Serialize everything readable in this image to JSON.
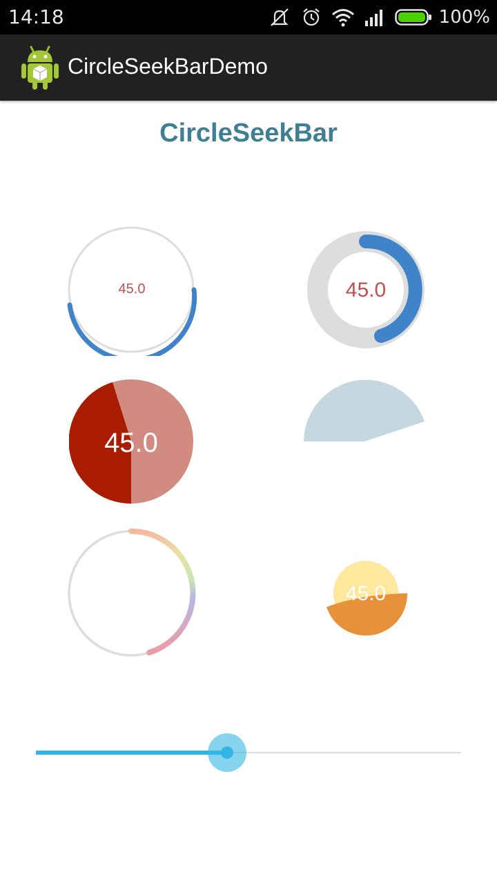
{
  "status_bar": {
    "time": "14:18",
    "battery_text": "100%",
    "icons": [
      "silent-icon",
      "alarm-icon",
      "wifi-icon",
      "signal-icon",
      "battery-icon"
    ]
  },
  "action_bar": {
    "app_icon": "android-icon",
    "title": "CircleSeekBarDemo"
  },
  "page": {
    "title": "CircleSeekBar"
  },
  "seekbars": {
    "ring_blue": {
      "value_text": "45.0",
      "progress": 0.45,
      "track_color": "#dddddd",
      "progress_color": "#3f84c9",
      "text_color": "#c0504d"
    },
    "ring_thick": {
      "value_text": "45.0",
      "progress": 0.45,
      "track_color": "#dddddd",
      "progress_color": "#3f84c9",
      "text_color": "#c0504d"
    },
    "pie_red": {
      "value_text": "45.0",
      "progress": 0.45,
      "track_color": "#d28b80",
      "progress_color": "#a91c00",
      "text_color": "#ffffff"
    },
    "sector_gray": {
      "progress": 0.45,
      "color": "#c5d8e0"
    },
    "ring_rainbow": {
      "progress": 0.45,
      "track_color": "#dddddd",
      "gradient": [
        "#f4b9a0",
        "#e9e2a4",
        "#c9e4b7",
        "#b7b7e0",
        "#f09aa6"
      ]
    },
    "fill_orange": {
      "value_text": "45.0",
      "progress": 0.45,
      "track_color": "#ffe79e",
      "progress_color": "#e7923b",
      "text_color": "#ffffff"
    }
  },
  "slider": {
    "progress": 0.45,
    "track_color": "#dddddd",
    "progress_color": "#33b5e5"
  }
}
